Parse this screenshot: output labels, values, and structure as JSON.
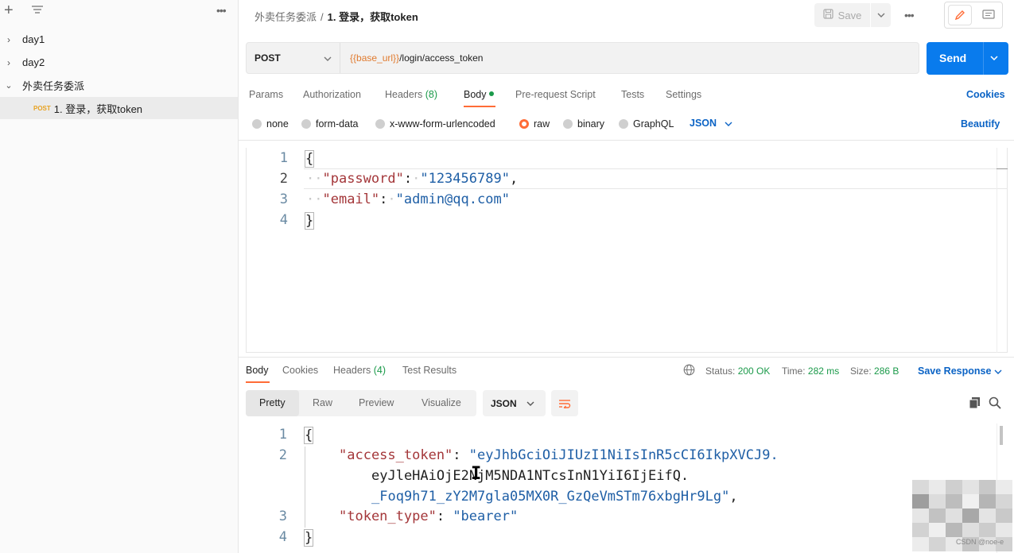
{
  "sidebar": {
    "items": [
      {
        "label": "day1",
        "chevron": "›"
      },
      {
        "label": "day2",
        "chevron": "›"
      },
      {
        "label": "外卖任务委派",
        "chevron": "⌄"
      }
    ],
    "request": {
      "method": "POST",
      "label": "1. 登录，获取token"
    }
  },
  "header": {
    "breadcrumb_parent": "外卖任务委派",
    "breadcrumb_sep": "/",
    "breadcrumb_current": "1. 登录，获取token",
    "save_label": "Save"
  },
  "request": {
    "method": "POST",
    "url_var": "{{base_url}}",
    "url_path": "/login/access_token",
    "send_label": "Send"
  },
  "tabs": {
    "params": "Params",
    "authorization": "Authorization",
    "headers": "Headers",
    "headers_count": "(8)",
    "body": "Body",
    "prerequest": "Pre-request Script",
    "tests": "Tests",
    "settings": "Settings",
    "cookies": "Cookies"
  },
  "body_types": {
    "none": "none",
    "form_data": "form-data",
    "urlencoded": "x-www-form-urlencoded",
    "raw": "raw",
    "binary": "binary",
    "graphql": "GraphQL",
    "json": "JSON",
    "beautify": "Beautify"
  },
  "request_body": {
    "line_numbers": [
      "1",
      "2",
      "3",
      "4"
    ],
    "open": "{",
    "close": "}",
    "k1": "\"password\"",
    "v1": "\"123456789\"",
    "k2": "\"email\"",
    "v2": "\"admin@qq.com\""
  },
  "response": {
    "tabs": {
      "body": "Body",
      "cookies": "Cookies",
      "headers": "Headers",
      "headers_count": "(4)",
      "test_results": "Test Results"
    },
    "status_label": "Status:",
    "status_value": "200 OK",
    "time_label": "Time:",
    "time_value": "282 ms",
    "size_label": "Size:",
    "size_value": "286 B",
    "save_response": "Save Response",
    "views": {
      "pretty": "Pretty",
      "raw": "Raw",
      "preview": "Preview",
      "visualize": "Visualize"
    },
    "format": "JSON",
    "body": {
      "line_numbers": [
        "1",
        "2",
        "3",
        "4"
      ],
      "open": "{",
      "close": "}",
      "k1": "\"access_token\"",
      "v1_a": "\"eyJhbGciOiJIUzI1NiIsInR5cCI6IkpXVCJ9.",
      "v1_b": "eyJleHAiOjE2NjM5NDA1NTcsInN1YiI6IjEifQ.",
      "v1_c": "_Foq9h71_zY2M7gla05MX0R_GzQeVmSTm76xbgHr9Lg\"",
      "k2": "\"token_type\"",
      "v2": "\"bearer\""
    }
  },
  "watermark": "CSDN @noe-e",
  "colors": {
    "accent": "#ff6c37",
    "send": "#097bed",
    "link": "#0b63c5",
    "status_ok": "#1b9a4a",
    "json_key": "#a4373a",
    "json_string": "#1f5fa6"
  }
}
